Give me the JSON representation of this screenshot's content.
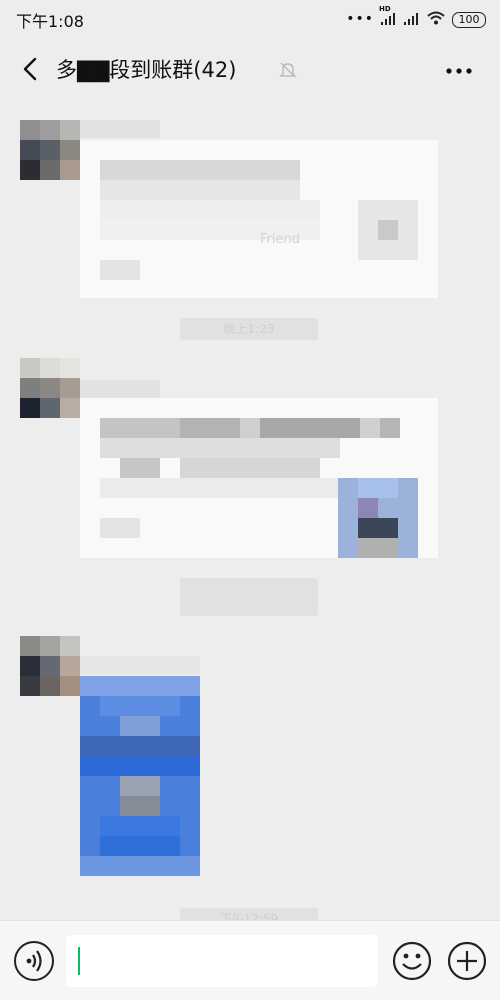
{
  "status_bar": {
    "time": "下午1:08",
    "signal_label": "HD",
    "battery": "100"
  },
  "header": {
    "title": "多▇▇段到账群(42)",
    "icons": [
      "back-arrow-icon",
      "mute-bell-icon",
      "more-dots-icon"
    ]
  },
  "messages": [
    {
      "type": "card",
      "blurred": true,
      "visible_fragment": "Friend"
    },
    {
      "type": "time",
      "blurred": true,
      "visible_fragment": "晚上1:23"
    },
    {
      "type": "card",
      "blurred": true
    },
    {
      "type": "time",
      "blurred": true
    },
    {
      "type": "image",
      "blurred": true
    },
    {
      "type": "time",
      "blurred": true,
      "visible_fragment": "下午12:59"
    }
  ],
  "input_bar": {
    "value": "",
    "icons": [
      "voice-icon",
      "emoji-icon",
      "plus-icon"
    ]
  },
  "colors": {
    "background": "#ededed",
    "accent": "#07c160",
    "image_blue": "#4a7fdc"
  }
}
